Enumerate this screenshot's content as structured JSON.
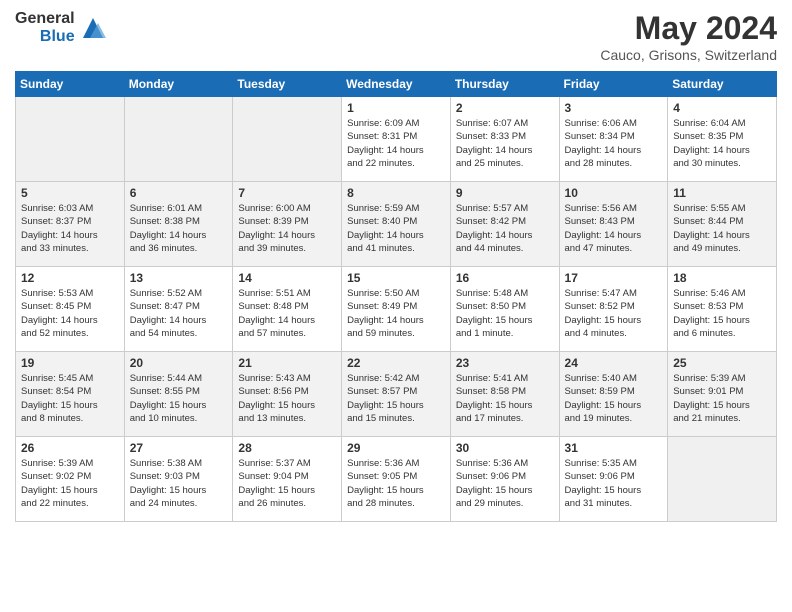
{
  "header": {
    "logo_general": "General",
    "logo_blue": "Blue",
    "month_year": "May 2024",
    "location": "Cauco, Grisons, Switzerland"
  },
  "days_of_week": [
    "Sunday",
    "Monday",
    "Tuesday",
    "Wednesday",
    "Thursday",
    "Friday",
    "Saturday"
  ],
  "weeks": [
    [
      {
        "day": "",
        "info": ""
      },
      {
        "day": "",
        "info": ""
      },
      {
        "day": "",
        "info": ""
      },
      {
        "day": "1",
        "info": "Sunrise: 6:09 AM\nSunset: 8:31 PM\nDaylight: 14 hours\nand 22 minutes."
      },
      {
        "day": "2",
        "info": "Sunrise: 6:07 AM\nSunset: 8:33 PM\nDaylight: 14 hours\nand 25 minutes."
      },
      {
        "day": "3",
        "info": "Sunrise: 6:06 AM\nSunset: 8:34 PM\nDaylight: 14 hours\nand 28 minutes."
      },
      {
        "day": "4",
        "info": "Sunrise: 6:04 AM\nSunset: 8:35 PM\nDaylight: 14 hours\nand 30 minutes."
      }
    ],
    [
      {
        "day": "5",
        "info": "Sunrise: 6:03 AM\nSunset: 8:37 PM\nDaylight: 14 hours\nand 33 minutes."
      },
      {
        "day": "6",
        "info": "Sunrise: 6:01 AM\nSunset: 8:38 PM\nDaylight: 14 hours\nand 36 minutes."
      },
      {
        "day": "7",
        "info": "Sunrise: 6:00 AM\nSunset: 8:39 PM\nDaylight: 14 hours\nand 39 minutes."
      },
      {
        "day": "8",
        "info": "Sunrise: 5:59 AM\nSunset: 8:40 PM\nDaylight: 14 hours\nand 41 minutes."
      },
      {
        "day": "9",
        "info": "Sunrise: 5:57 AM\nSunset: 8:42 PM\nDaylight: 14 hours\nand 44 minutes."
      },
      {
        "day": "10",
        "info": "Sunrise: 5:56 AM\nSunset: 8:43 PM\nDaylight: 14 hours\nand 47 minutes."
      },
      {
        "day": "11",
        "info": "Sunrise: 5:55 AM\nSunset: 8:44 PM\nDaylight: 14 hours\nand 49 minutes."
      }
    ],
    [
      {
        "day": "12",
        "info": "Sunrise: 5:53 AM\nSunset: 8:45 PM\nDaylight: 14 hours\nand 52 minutes."
      },
      {
        "day": "13",
        "info": "Sunrise: 5:52 AM\nSunset: 8:47 PM\nDaylight: 14 hours\nand 54 minutes."
      },
      {
        "day": "14",
        "info": "Sunrise: 5:51 AM\nSunset: 8:48 PM\nDaylight: 14 hours\nand 57 minutes."
      },
      {
        "day": "15",
        "info": "Sunrise: 5:50 AM\nSunset: 8:49 PM\nDaylight: 14 hours\nand 59 minutes."
      },
      {
        "day": "16",
        "info": "Sunrise: 5:48 AM\nSunset: 8:50 PM\nDaylight: 15 hours\nand 1 minute."
      },
      {
        "day": "17",
        "info": "Sunrise: 5:47 AM\nSunset: 8:52 PM\nDaylight: 15 hours\nand 4 minutes."
      },
      {
        "day": "18",
        "info": "Sunrise: 5:46 AM\nSunset: 8:53 PM\nDaylight: 15 hours\nand 6 minutes."
      }
    ],
    [
      {
        "day": "19",
        "info": "Sunrise: 5:45 AM\nSunset: 8:54 PM\nDaylight: 15 hours\nand 8 minutes."
      },
      {
        "day": "20",
        "info": "Sunrise: 5:44 AM\nSunset: 8:55 PM\nDaylight: 15 hours\nand 10 minutes."
      },
      {
        "day": "21",
        "info": "Sunrise: 5:43 AM\nSunset: 8:56 PM\nDaylight: 15 hours\nand 13 minutes."
      },
      {
        "day": "22",
        "info": "Sunrise: 5:42 AM\nSunset: 8:57 PM\nDaylight: 15 hours\nand 15 minutes."
      },
      {
        "day": "23",
        "info": "Sunrise: 5:41 AM\nSunset: 8:58 PM\nDaylight: 15 hours\nand 17 minutes."
      },
      {
        "day": "24",
        "info": "Sunrise: 5:40 AM\nSunset: 8:59 PM\nDaylight: 15 hours\nand 19 minutes."
      },
      {
        "day": "25",
        "info": "Sunrise: 5:39 AM\nSunset: 9:01 PM\nDaylight: 15 hours\nand 21 minutes."
      }
    ],
    [
      {
        "day": "26",
        "info": "Sunrise: 5:39 AM\nSunset: 9:02 PM\nDaylight: 15 hours\nand 22 minutes."
      },
      {
        "day": "27",
        "info": "Sunrise: 5:38 AM\nSunset: 9:03 PM\nDaylight: 15 hours\nand 24 minutes."
      },
      {
        "day": "28",
        "info": "Sunrise: 5:37 AM\nSunset: 9:04 PM\nDaylight: 15 hours\nand 26 minutes."
      },
      {
        "day": "29",
        "info": "Sunrise: 5:36 AM\nSunset: 9:05 PM\nDaylight: 15 hours\nand 28 minutes."
      },
      {
        "day": "30",
        "info": "Sunrise: 5:36 AM\nSunset: 9:06 PM\nDaylight: 15 hours\nand 29 minutes."
      },
      {
        "day": "31",
        "info": "Sunrise: 5:35 AM\nSunset: 9:06 PM\nDaylight: 15 hours\nand 31 minutes."
      },
      {
        "day": "",
        "info": ""
      }
    ]
  ]
}
